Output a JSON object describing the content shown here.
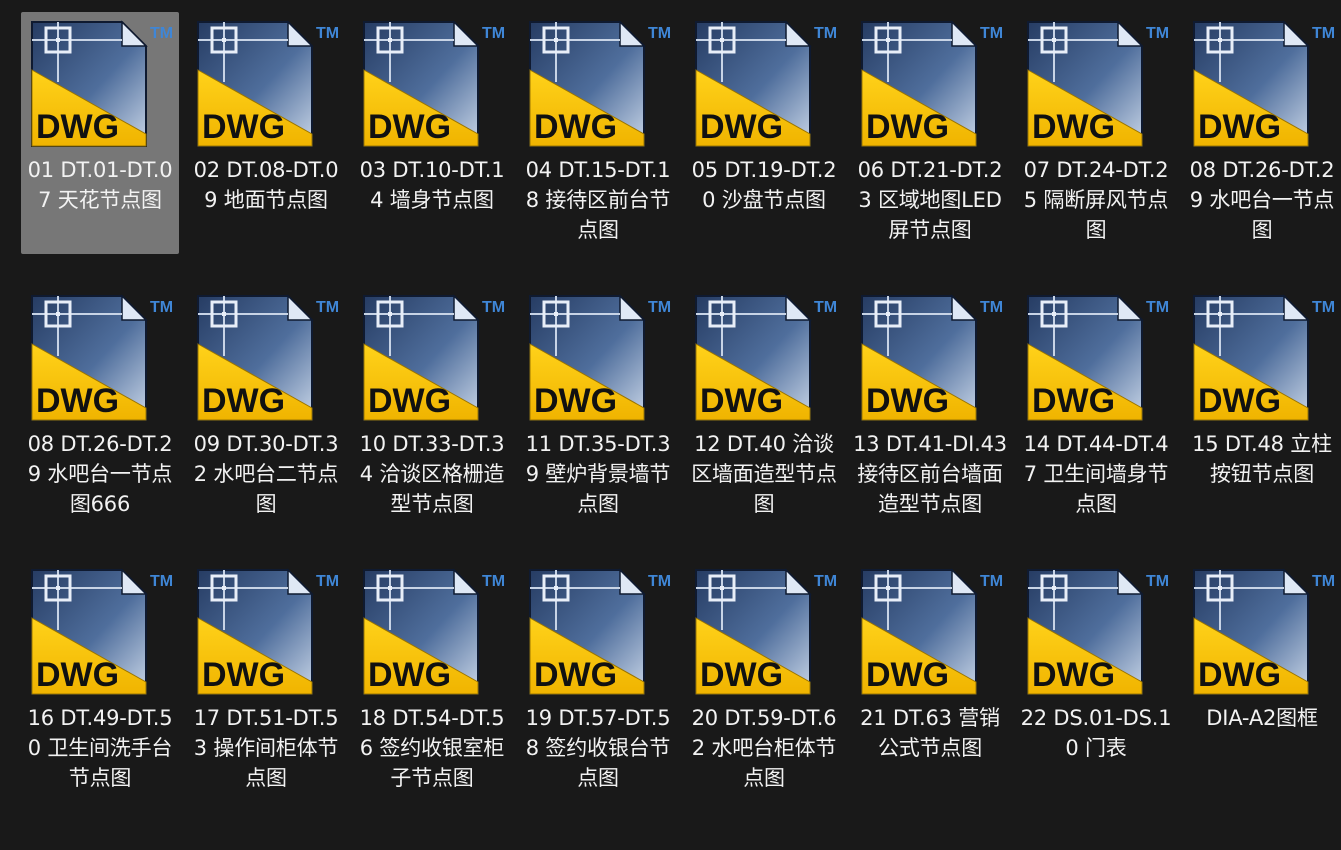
{
  "icon": {
    "name": "dwg-file-icon",
    "text": "DWG",
    "tm": "TM"
  },
  "items": [
    {
      "label": "01 DT.01-DT.07 天花节点图",
      "selected": true
    },
    {
      "label": "02 DT.08-DT.09 地面节点图"
    },
    {
      "label": "03 DT.10-DT.14 墙身节点图"
    },
    {
      "label": "04 DT.15-DT.18 接待区前台节点图"
    },
    {
      "label": "05 DT.19-DT.20 沙盘节点图"
    },
    {
      "label": "06 DT.21-DT.23 区域地图LED屏节点图"
    },
    {
      "label": "07 DT.24-DT.25 隔断屏风节点图"
    },
    {
      "label": "08 DT.26-DT.29 水吧台一节点图"
    },
    {
      "label": "08 DT.26-DT.29 水吧台一节点图666"
    },
    {
      "label": "09 DT.30-DT.32 水吧台二节点图"
    },
    {
      "label": "10 DT.33-DT.34 洽谈区格栅造型节点图"
    },
    {
      "label": "11 DT.35-DT.39 壁炉背景墙节点图"
    },
    {
      "label": "12 DT.40 洽谈区墙面造型节点图"
    },
    {
      "label": "13 DT.41-DI.43 接待区前台墙面造型节点图"
    },
    {
      "label": "14 DT.44-DT.47 卫生间墙身节点图"
    },
    {
      "label": "15 DT.48 立柱按钮节点图"
    },
    {
      "label": "16 DT.49-DT.50 卫生间洗手台节点图"
    },
    {
      "label": "17 DT.51-DT.53 操作间柜体节点图"
    },
    {
      "label": "18 DT.54-DT.56 签约收银室柜子节点图"
    },
    {
      "label": "19 DT.57-DT.58 签约收银台节点图"
    },
    {
      "label": "20 DT.59-DT.62 水吧台柜体节点图"
    },
    {
      "label": "21 DT.63 营销公式节点图"
    },
    {
      "label": "22 DS.01-DS.10 门表"
    },
    {
      "label": "DIA-A2图框"
    }
  ]
}
